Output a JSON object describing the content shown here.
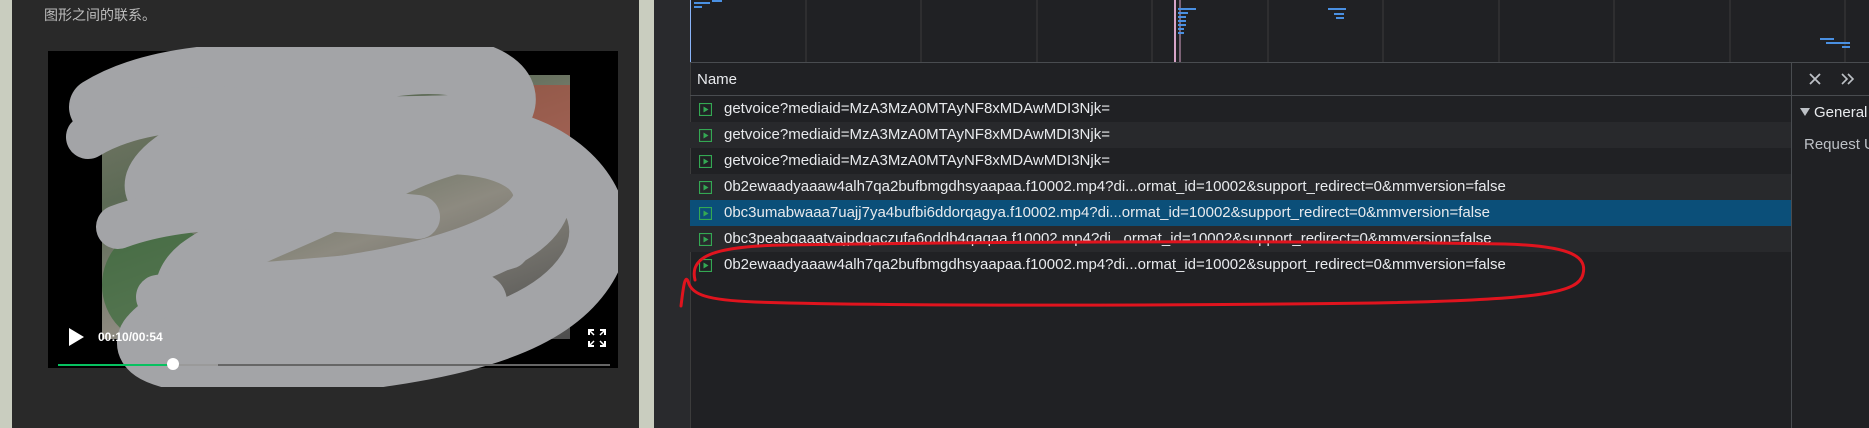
{
  "article": {
    "text_line": "图形之间的联系。"
  },
  "video": {
    "time_readout": "00:10/00:54",
    "progress_fraction": 0.208,
    "buffer_fraction": 0.29,
    "accent_color": "#07c160"
  },
  "network": {
    "column_header": "Name",
    "requests": [
      {
        "name": "getvoice?mediaid=MzA3MzA0MTAyNF8xMDAwMDI3Njk="
      },
      {
        "name": "getvoice?mediaid=MzA3MzA0MTAyNF8xMDAwMDI3Njk="
      },
      {
        "name": "getvoice?mediaid=MzA3MzA0MTAyNF8xMDAwMDI3Njk="
      },
      {
        "name": "0b2ewaadyaaaw4alh7qa2bufbmgdhsyaapaa.f10002.mp4?di...ormat_id=10002&support_redirect=0&mmversion=false"
      },
      {
        "name": "0bc3umabwaaa7uajj7ya4bufbi6ddorqagya.f10002.mp4?di...ormat_id=10002&support_redirect=0&mmversion=false",
        "selected": true
      },
      {
        "name": "0bc3peabqaaatyajpdqaczufa6oddb4qaqaa.f10002.mp4?di...ormat_id=10002&support_redirect=0&mmversion=false"
      },
      {
        "name": "0b2ewaadyaaaw4alh7qa2bufbmgdhsyaapaa.f10002.mp4?di...ormat_id=10002&support_redirect=0&mmversion=false",
        "annotated": true
      }
    ],
    "selected_row_color": "#0b4f79",
    "annotation_color": "#e0141e"
  },
  "details": {
    "section_label": "General",
    "first_field_label": "Request U"
  },
  "icons": {
    "play": "play-icon",
    "fullscreen": "fullscreen-icon",
    "close": "close-icon",
    "more_tabs": "double-chevron-icon",
    "request_file": "media-file-icon"
  }
}
